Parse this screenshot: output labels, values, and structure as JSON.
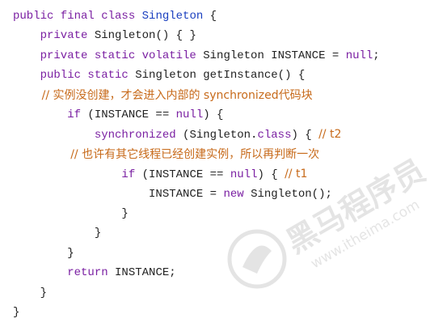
{
  "colors": {
    "background": "#ffffff",
    "keyword": "#7a1fa2",
    "type_name": "#1a3fbf",
    "plain": "#1f1f1f",
    "comment": "#c76a1a",
    "watermark": "#8a8a8a"
  },
  "watermark": {
    "brand": "黑马程序员",
    "url": "www.itheima.com"
  },
  "code": {
    "lines": [
      [
        {
          "t": "public final class ",
          "k": "kw"
        },
        {
          "t": "Singleton",
          "k": "type"
        },
        {
          "t": " {",
          "k": "plain"
        }
      ],
      [
        {
          "t": "    private ",
          "k": "kw"
        },
        {
          "t": "Singleton() { }",
          "k": "plain"
        }
      ],
      [
        {
          "t": "    private static volatile ",
          "k": "kw"
        },
        {
          "t": "Singleton INSTANCE = ",
          "k": "plain"
        },
        {
          "t": "null",
          "k": "kw"
        },
        {
          "t": ";",
          "k": "plain"
        }
      ],
      [
        {
          "t": "    public static ",
          "k": "kw"
        },
        {
          "t": "Singleton getInstance() {",
          "k": "plain"
        }
      ],
      [
        {
          "t": "        // 实例没创建，才会进入内部的 synchronized代码块",
          "k": "comment"
        }
      ],
      [
        {
          "t": "        if ",
          "k": "kw"
        },
        {
          "t": "(INSTANCE == ",
          "k": "plain"
        },
        {
          "t": "null",
          "k": "kw"
        },
        {
          "t": ") {",
          "k": "plain"
        }
      ],
      [
        {
          "t": "            synchronized ",
          "k": "kw"
        },
        {
          "t": "(Singleton.",
          "k": "plain"
        },
        {
          "t": "class",
          "k": "kw"
        },
        {
          "t": ") { ",
          "k": "plain"
        },
        {
          "t": "// t2",
          "k": "comment"
        }
      ],
      [
        {
          "t": "                // 也许有其它线程已经创建实例，所以再判断一次",
          "k": "comment"
        }
      ],
      [
        {
          "t": "                if ",
          "k": "kw"
        },
        {
          "t": "(INSTANCE == ",
          "k": "plain"
        },
        {
          "t": "null",
          "k": "kw"
        },
        {
          "t": ") { ",
          "k": "plain"
        },
        {
          "t": "// t1",
          "k": "comment"
        }
      ],
      [
        {
          "t": "                    INSTANCE = ",
          "k": "plain"
        },
        {
          "t": "new ",
          "k": "kw"
        },
        {
          "t": "Singleton();",
          "k": "plain"
        }
      ],
      [
        {
          "t": "                }",
          "k": "plain"
        }
      ],
      [
        {
          "t": "            }",
          "k": "plain"
        }
      ],
      [
        {
          "t": "        }",
          "k": "plain"
        }
      ],
      [
        {
          "t": "        return ",
          "k": "kw"
        },
        {
          "t": "INSTANCE;",
          "k": "plain"
        }
      ],
      [
        {
          "t": "    }",
          "k": "plain"
        }
      ],
      [
        {
          "t": "}",
          "k": "plain"
        }
      ]
    ]
  }
}
